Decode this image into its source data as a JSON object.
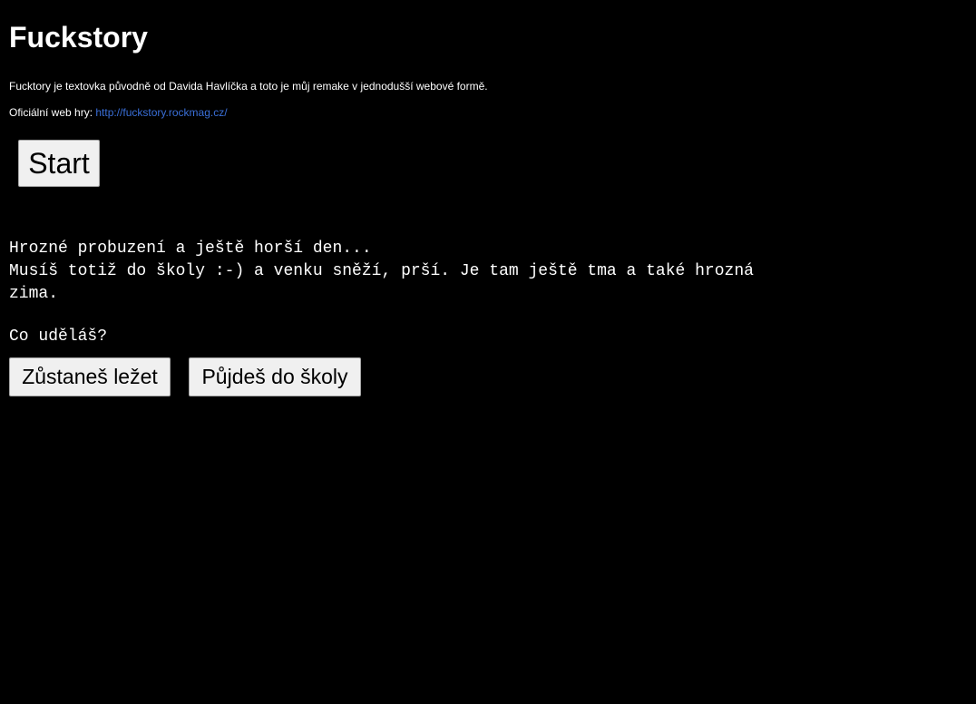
{
  "header": {
    "title": "Fuckstory"
  },
  "intro": {
    "text": "Fucktory je textovka původně od Davida Havlíčka a toto je můj remake v jednodušší webové formě.",
    "official_label": "Oficiální web hry: ",
    "official_link": "http://fuckstory.rockmag.cz/"
  },
  "controls": {
    "start_label": "Start"
  },
  "story": {
    "lines": [
      "Hrozné probuzení a ještě horší den...",
      "Musíš totiž do školy :-) a venku sněží, prší. Je tam ještě tma a také hrozná",
      "zima."
    ],
    "question": "Co uděláš?"
  },
  "choices": {
    "stay_label": "Zůstaneš ležet",
    "go_label": "Půjdeš do školy"
  },
  "colors": {
    "background": "#000000",
    "text": "#ffffff",
    "link": "#3a6fd8",
    "button_bg": "#f0f0f0"
  }
}
